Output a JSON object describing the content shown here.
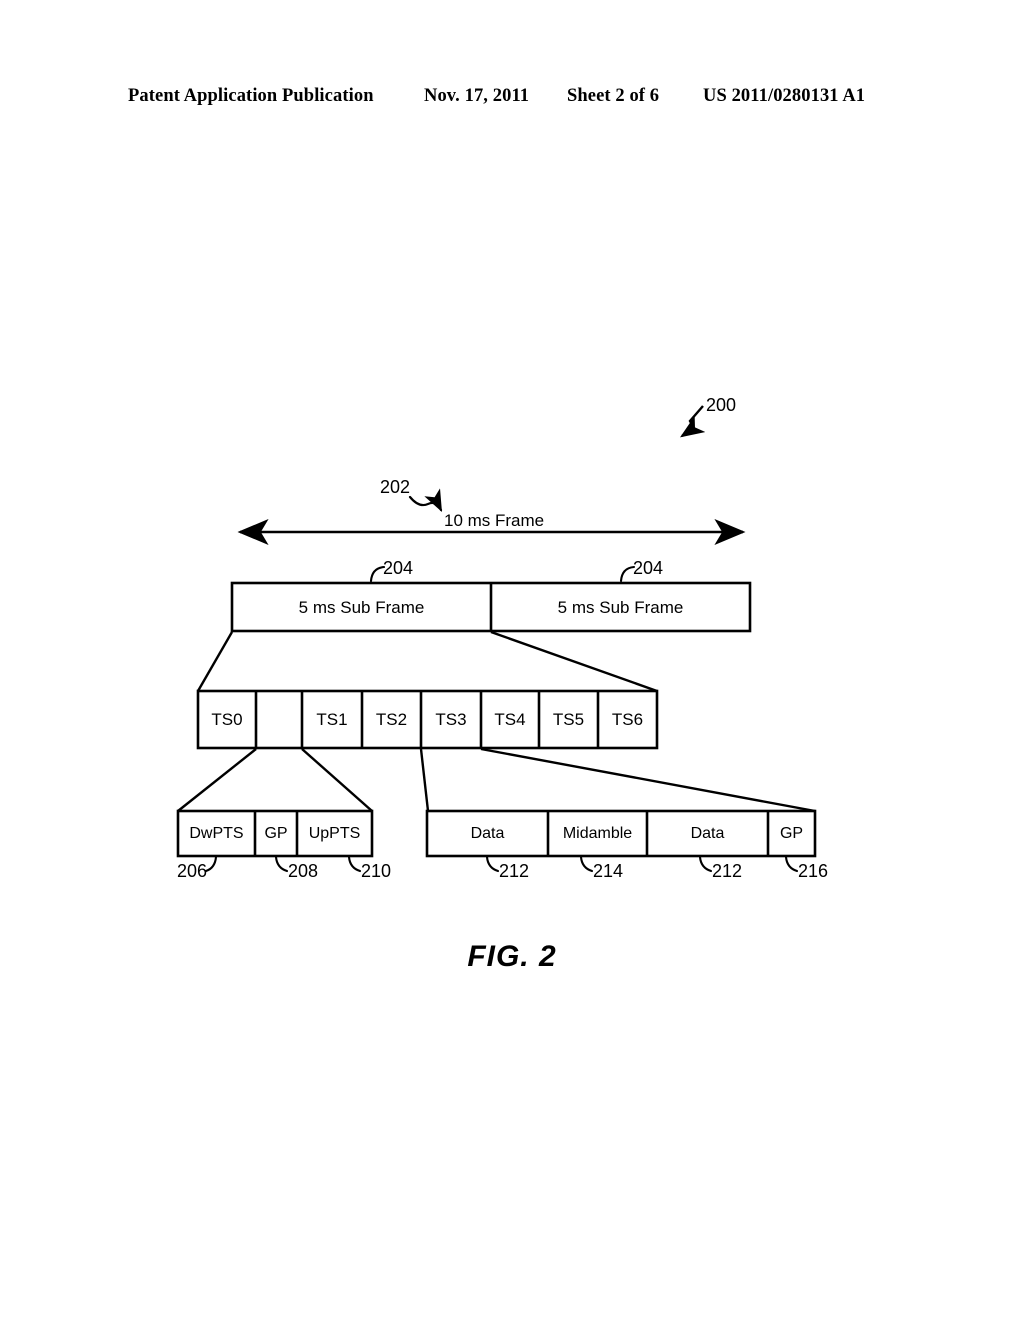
{
  "header": {
    "publication": "Patent Application Publication",
    "date": "Nov. 17, 2011",
    "sheet": "Sheet 2 of 6",
    "patent_number": "US 2011/0280131 A1"
  },
  "figure": {
    "caption": "FIG. 2",
    "overall_ref": "200",
    "frame_arrow": {
      "label": "10 ms Frame",
      "ref": "202"
    },
    "subframe_row": {
      "ref_left": "204",
      "ref_right": "204",
      "cells": [
        {
          "label": "5 ms Sub Frame"
        },
        {
          "label": "5 ms Sub Frame"
        }
      ]
    },
    "timeslot_row": {
      "cells": [
        {
          "label": "TS0"
        },
        {
          "label": ""
        },
        {
          "label": "TS1"
        },
        {
          "label": "TS2"
        },
        {
          "label": "TS3"
        },
        {
          "label": "TS4"
        },
        {
          "label": "TS5"
        },
        {
          "label": "TS6"
        }
      ]
    },
    "special_slot_row": {
      "cells": [
        {
          "label": "DwPTS",
          "ref": "206"
        },
        {
          "label": "GP",
          "ref": "208"
        },
        {
          "label": "UpPTS",
          "ref": "210"
        }
      ]
    },
    "traffic_slot_row": {
      "cells": [
        {
          "label": "Data",
          "ref": "212"
        },
        {
          "label": "Midamble",
          "ref": "214"
        },
        {
          "label": "Data",
          "ref": "212"
        },
        {
          "label": "GP",
          "ref": "216"
        }
      ]
    }
  },
  "colors": {
    "ink": "#000000",
    "paper": "#ffffff"
  }
}
